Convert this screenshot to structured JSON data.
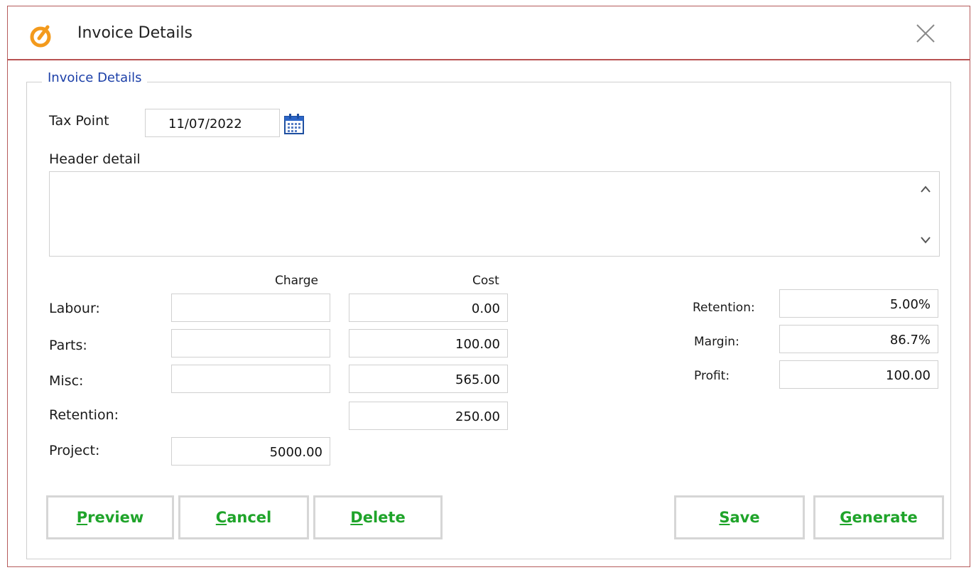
{
  "window": {
    "title": "Invoice Details"
  },
  "group": {
    "legend": "Invoice Details"
  },
  "tax_point": {
    "label": "Tax Point",
    "value": "11/07/2022"
  },
  "header_detail": {
    "label": "Header detail",
    "value": ""
  },
  "columns": {
    "charge": "Charge",
    "cost": "Cost"
  },
  "rows": {
    "labour": {
      "label": "Labour:",
      "charge": "",
      "cost": "0.00"
    },
    "parts": {
      "label": "Parts:",
      "charge": "",
      "cost": "100.00"
    },
    "misc": {
      "label": "Misc:",
      "charge": "",
      "cost": "565.00"
    },
    "retention": {
      "label": "Retention:",
      "cost": "250.00"
    },
    "project": {
      "label": "Project:",
      "charge": "5000.00"
    }
  },
  "summary": {
    "retention": {
      "label": "Retention:",
      "value": "5.00%"
    },
    "margin": {
      "label": "Margin:",
      "value": "86.7%"
    },
    "profit": {
      "label": "Profit:",
      "value": "100.00"
    }
  },
  "buttons": {
    "preview": {
      "accel": "P",
      "rest": "review"
    },
    "cancel": {
      "accel": "C",
      "rest": "ancel"
    },
    "delete": {
      "accel": "D",
      "rest": "elete"
    },
    "save": {
      "accel": "S",
      "rest": "ave"
    },
    "generate": {
      "accel": "G",
      "rest": "enerate"
    }
  },
  "colors": {
    "accent_green": "#1fa42a",
    "legend_blue": "#1b3fa8",
    "border_red": "#b85252",
    "icon_orange": "#f39a1c"
  },
  "icons": {
    "app": "app-logo-icon",
    "close": "close-icon",
    "calendar": "calendar-icon",
    "scroll_up": "chevron-up-icon",
    "scroll_down": "chevron-down-icon"
  }
}
